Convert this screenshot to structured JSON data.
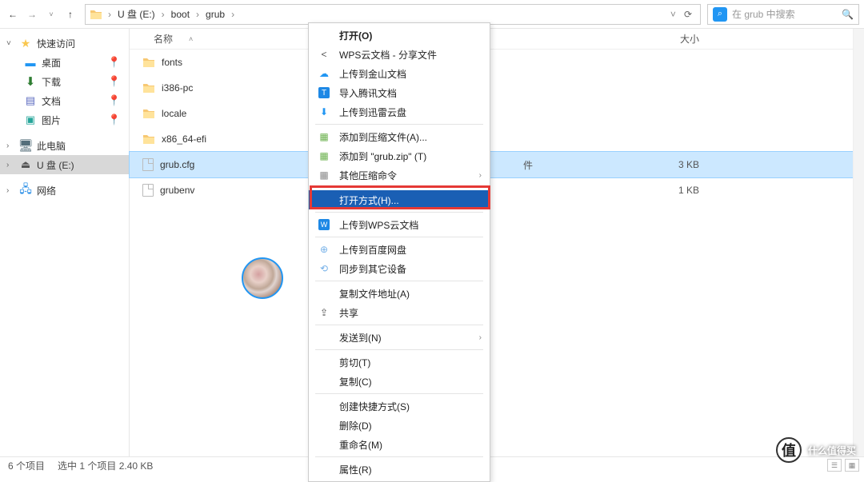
{
  "toolbar": {
    "breadcrumbs": [
      "U 盘 (E:)",
      "boot",
      "grub"
    ],
    "search_placeholder": "在 grub 中搜索"
  },
  "sidebar": {
    "items": [
      {
        "label": "快速访问"
      },
      {
        "label": "桌面"
      },
      {
        "label": "下载"
      },
      {
        "label": "文档"
      },
      {
        "label": "图片"
      },
      {
        "label": "此电脑"
      },
      {
        "label": "U 盘 (E:)"
      },
      {
        "label": "网络"
      }
    ]
  },
  "columns": {
    "name": "名称",
    "size": "大小"
  },
  "files": [
    {
      "name": "fonts",
      "type": "folder",
      "size": ""
    },
    {
      "name": "i386-pc",
      "type": "folder",
      "size": ""
    },
    {
      "name": "locale",
      "type": "folder",
      "size": ""
    },
    {
      "name": "x86_64-efi",
      "type": "folder",
      "size": ""
    },
    {
      "name": "grub.cfg",
      "type": "file",
      "size": "3 KB",
      "selected": true,
      "partial_col": "件"
    },
    {
      "name": "grubenv",
      "type": "file",
      "size": "1 KB"
    }
  ],
  "context_menu": {
    "items": [
      {
        "label": "打开(O)",
        "bold": true,
        "icon": ""
      },
      {
        "label": "WPS云文档 - 分享文件",
        "icon": "share"
      },
      {
        "label": "上传到金山文档",
        "icon": "cloud-blue"
      },
      {
        "label": "导入腾讯文档",
        "icon": "tencent"
      },
      {
        "label": "上传到迅雷云盘",
        "icon": "thunder"
      },
      {
        "sep": true
      },
      {
        "label": "添加到压缩文件(A)...",
        "icon": "zip"
      },
      {
        "label": "添加到 \"grub.zip\" (T)",
        "icon": "zip"
      },
      {
        "label": "其他压缩命令",
        "icon": "zip-gray",
        "submenu": true
      },
      {
        "sep": true
      },
      {
        "label": "打开方式(H)...",
        "highlight": true,
        "icon": ""
      },
      {
        "sep": true
      },
      {
        "label": "上传到WPS云文档",
        "icon": "wps"
      },
      {
        "sep": true
      },
      {
        "label": "上传到百度网盘",
        "icon": "baidu"
      },
      {
        "label": "同步到其它设备",
        "icon": "sync"
      },
      {
        "sep": true
      },
      {
        "label": "复制文件地址(A)",
        "icon": ""
      },
      {
        "label": "共享",
        "icon": "share2"
      },
      {
        "sep": true
      },
      {
        "label": "发送到(N)",
        "submenu": true,
        "icon": ""
      },
      {
        "sep": true
      },
      {
        "label": "剪切(T)",
        "icon": ""
      },
      {
        "label": "复制(C)",
        "icon": ""
      },
      {
        "sep": true
      },
      {
        "label": "创建快捷方式(S)",
        "icon": ""
      },
      {
        "label": "删除(D)",
        "icon": ""
      },
      {
        "label": "重命名(M)",
        "icon": ""
      },
      {
        "sep": true
      },
      {
        "label": "属性(R)",
        "icon": ""
      }
    ]
  },
  "status": {
    "count": "6 个项目",
    "selected": "选中 1 个项目 2.40 KB"
  },
  "watermark": {
    "badge": "值",
    "text": "什么值得买"
  }
}
